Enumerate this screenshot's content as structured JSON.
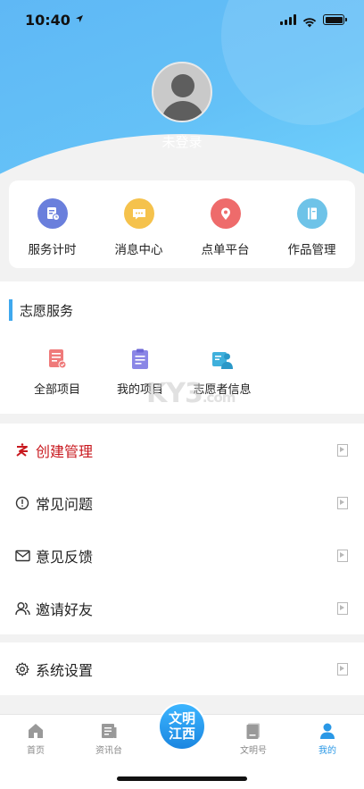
{
  "status": {
    "time": "10:40"
  },
  "profile": {
    "login_text": "未登录"
  },
  "quick": [
    {
      "label": "服务计时",
      "icon": "timer-doc-icon",
      "color": "#6a7fdc"
    },
    {
      "label": "消息中心",
      "icon": "message-icon",
      "color": "#f5c24c"
    },
    {
      "label": "点单平台",
      "icon": "location-pin-icon",
      "color": "#ee6b6b"
    },
    {
      "label": "作品管理",
      "icon": "book-icon",
      "color": "#6ec3e8"
    }
  ],
  "volunteer": {
    "title": "志愿服务",
    "items": [
      {
        "label": "全部项目",
        "icon": "project-list-icon"
      },
      {
        "label": "我的项目",
        "icon": "clipboard-icon"
      },
      {
        "label": "志愿者信息",
        "icon": "volunteer-card-icon"
      }
    ],
    "watermark": "KY3",
    "watermark_sub": ".com"
  },
  "menu1": [
    {
      "label": "创建管理",
      "icon": "create-manage-icon"
    },
    {
      "label": "常见问题",
      "icon": "exclamation-circle-icon"
    },
    {
      "label": "意见反馈",
      "icon": "mail-icon"
    },
    {
      "label": "邀请好友",
      "icon": "invite-friend-icon"
    }
  ],
  "menu2": [
    {
      "label": "系统设置",
      "icon": "gear-icon"
    }
  ],
  "tabbar": {
    "home": "首页",
    "news": "资讯台",
    "center_top": "文明",
    "center_bottom": "江西",
    "wenming": "文明号",
    "mine": "我的"
  },
  "colors": {
    "accent": "#2a98e6",
    "header": "#64c1f7",
    "red": "#c8181e"
  }
}
